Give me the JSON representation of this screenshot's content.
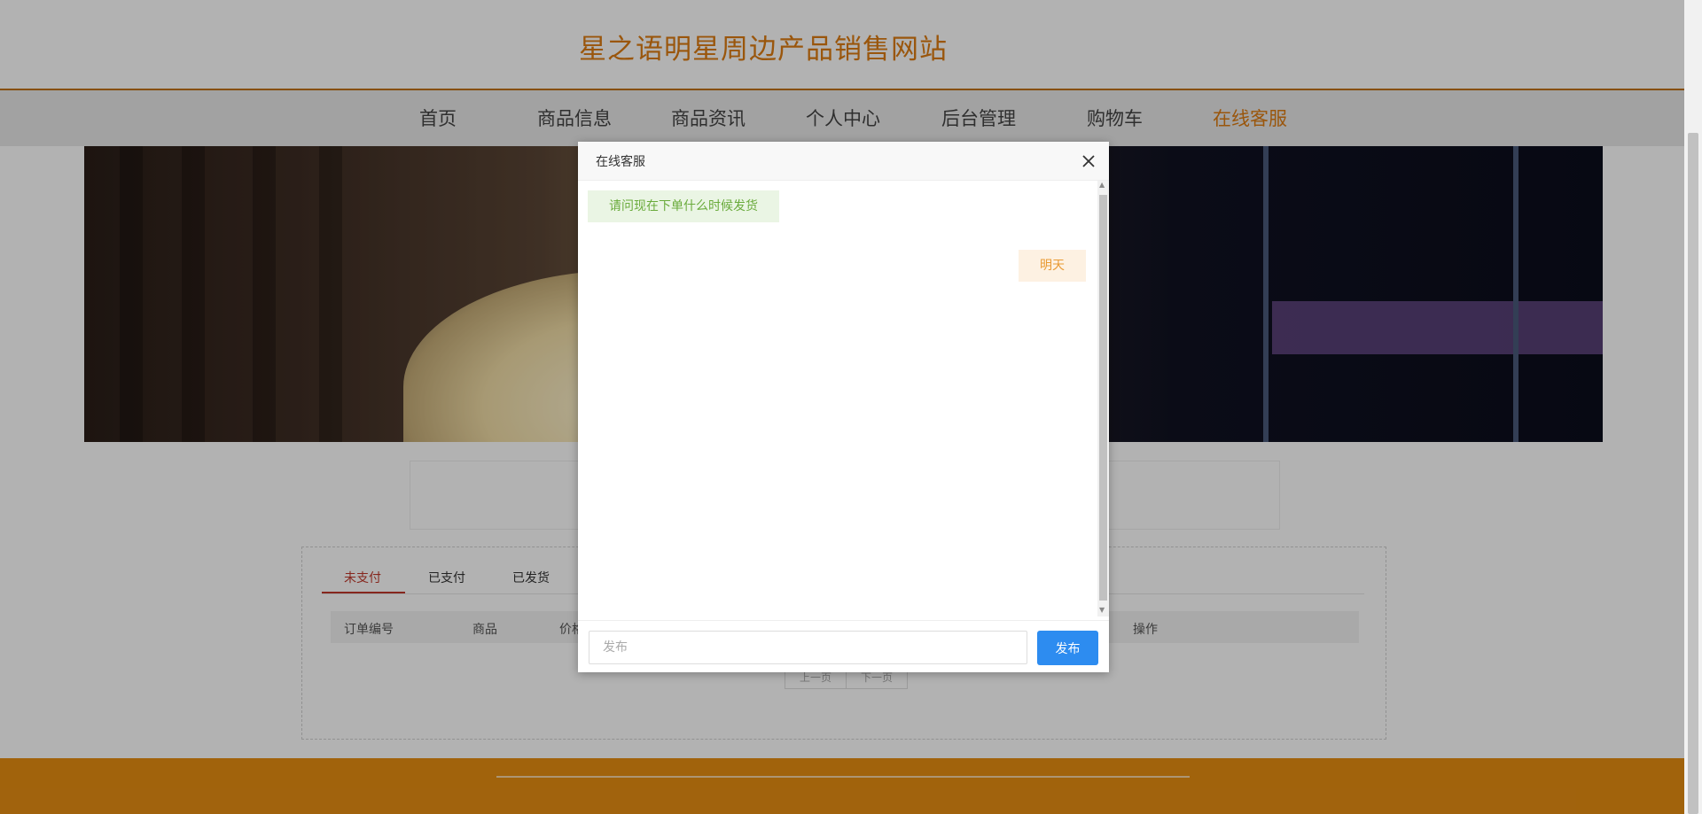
{
  "header": {
    "title": "星之语明星周边产品销售网站"
  },
  "nav": {
    "items": [
      {
        "label": "首页"
      },
      {
        "label": "商品信息"
      },
      {
        "label": "商品资讯"
      },
      {
        "label": "个人中心"
      },
      {
        "label": "后台管理"
      },
      {
        "label": "购物车"
      },
      {
        "label": "在线客服",
        "active": true
      }
    ]
  },
  "orders": {
    "tabs": [
      "未支付",
      "已支付",
      "已发货"
    ],
    "columns": [
      "订单编号",
      "商品",
      "价格",
      "操作"
    ],
    "pager": {
      "prev": "上一页",
      "next": "下一页"
    }
  },
  "dialog": {
    "title": "在线客服",
    "messages": [
      {
        "side": "left",
        "text": "请问现在下单什么时候发货"
      },
      {
        "side": "right",
        "text": "明天"
      }
    ],
    "input_placeholder": "发布",
    "send_label": "发布",
    "close_icon": "close-icon"
  },
  "colors": {
    "brand": "#dd7c12",
    "footer": "#e78e12",
    "send_button": "#2d8cf0"
  }
}
